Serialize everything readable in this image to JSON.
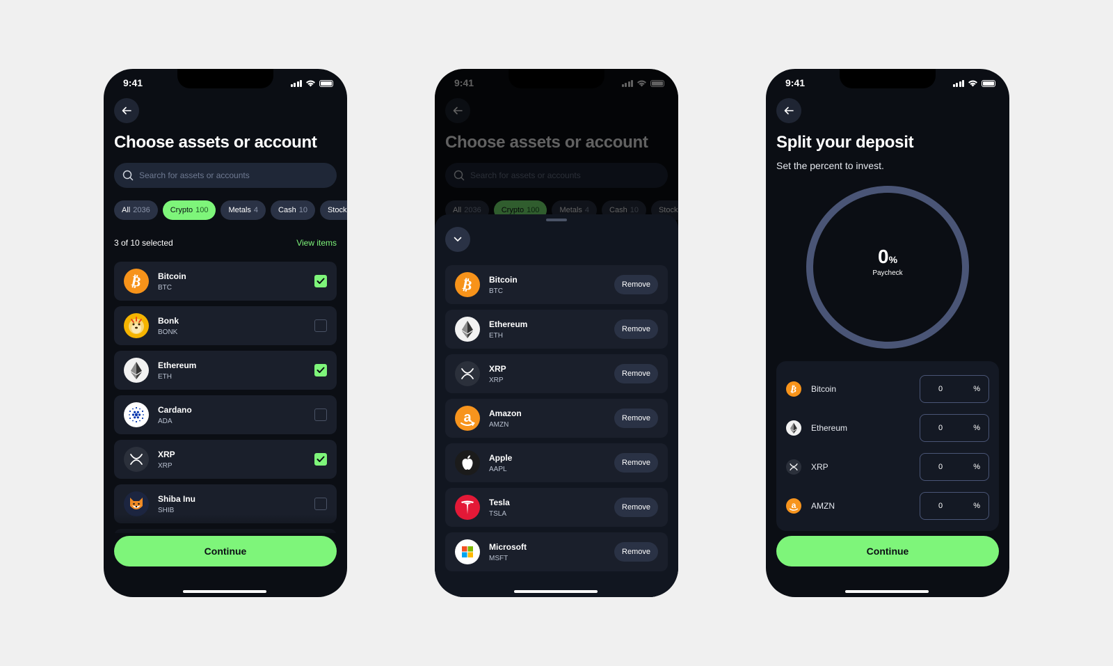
{
  "status": {
    "time": "9:41"
  },
  "screen1": {
    "title": "Choose assets or account",
    "search_placeholder": "Search for assets or accounts",
    "chips": [
      {
        "label": "All",
        "count": "2036",
        "active": false
      },
      {
        "label": "Crypto",
        "count": "100",
        "active": true
      },
      {
        "label": "Metals",
        "count": "4",
        "active": false
      },
      {
        "label": "Cash",
        "count": "10",
        "active": false
      },
      {
        "label": "Stocks",
        "count": "",
        "active": false
      }
    ],
    "selected_text": "3 of 10 selected",
    "view_items": "View items",
    "assets": [
      {
        "name": "Bitcoin",
        "ticker": "BTC",
        "icon": "bitcoin-icon",
        "checked": true
      },
      {
        "name": "Bonk",
        "ticker": "BONK",
        "icon": "bonk-icon",
        "checked": false
      },
      {
        "name": "Ethereum",
        "ticker": "ETH",
        "icon": "ethereum-icon",
        "checked": true
      },
      {
        "name": "Cardano",
        "ticker": "ADA",
        "icon": "cardano-icon",
        "checked": false
      },
      {
        "name": "XRP",
        "ticker": "XRP",
        "icon": "xrp-icon",
        "checked": true
      },
      {
        "name": "Shiba Inu",
        "ticker": "SHIB",
        "icon": "shiba-inu-icon",
        "checked": false
      }
    ],
    "continue_label": "Continue"
  },
  "screen2": {
    "remove_label": "Remove",
    "items": [
      {
        "name": "Bitcoin",
        "ticker": "BTC",
        "icon": "bitcoin-icon"
      },
      {
        "name": "Ethereum",
        "ticker": "ETH",
        "icon": "ethereum-icon"
      },
      {
        "name": "XRP",
        "ticker": "XRP",
        "icon": "xrp-icon"
      },
      {
        "name": "Amazon",
        "ticker": "AMZN",
        "icon": "amazon-icon"
      },
      {
        "name": "Apple",
        "ticker": "AAPL",
        "icon": "apple-icon"
      },
      {
        "name": "Tesla",
        "ticker": "TSLA",
        "icon": "tesla-icon"
      },
      {
        "name": "Microsoft",
        "ticker": "MSFT",
        "icon": "microsoft-icon"
      }
    ]
  },
  "screen3": {
    "title": "Split your deposit",
    "subtitle": "Set the percent to invest.",
    "total_value": "0",
    "total_symbol": "%",
    "total_label": "Paycheck",
    "allocations": [
      {
        "name": "Bitcoin",
        "value": "0",
        "unit": "%",
        "icon": "bitcoin-icon"
      },
      {
        "name": "Ethereum",
        "value": "0",
        "unit": "%",
        "icon": "ethereum-icon"
      },
      {
        "name": "XRP",
        "value": "0",
        "unit": "%",
        "icon": "xrp-icon"
      },
      {
        "name": "AMZN",
        "value": "0",
        "unit": "%",
        "icon": "amazon-icon"
      }
    ],
    "continue_label": "Continue"
  },
  "colors": {
    "accent": "#7ef57a",
    "background": "#0b0e14",
    "card": "#1a1f2b",
    "ring": "#4a5576",
    "bitcoin": "#f7931a",
    "tesla": "#e31937"
  }
}
